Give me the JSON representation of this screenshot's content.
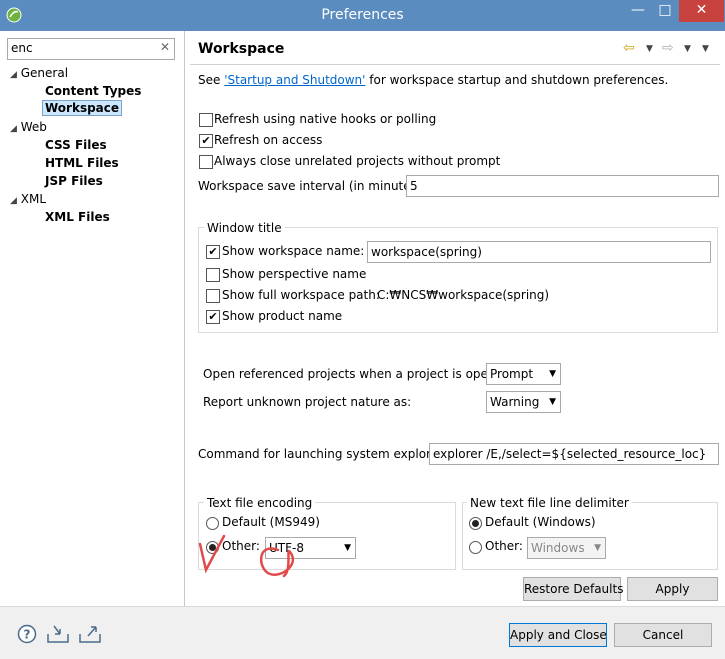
{
  "window": {
    "title": "Preferences",
    "minimize": "—",
    "maximize": "□",
    "close": "✕"
  },
  "filter": {
    "value": "enc",
    "clear": "✕"
  },
  "tree": [
    {
      "label": "General",
      "children": [
        "Content Types",
        "Workspace"
      ]
    },
    {
      "label": "Web",
      "children": [
        "CSS Files",
        "HTML Files",
        "JSP Files"
      ]
    },
    {
      "label": "XML",
      "children": [
        "XML Files"
      ]
    }
  ],
  "page": {
    "title": "Workspace",
    "see_prefix": "See ",
    "see_link": "'Startup and Shutdown'",
    "see_suffix": " for workspace startup and shutdown preferences.",
    "refresh_native": "Refresh using native hooks or polling",
    "refresh_access": "Refresh on access",
    "always_close": "Always close unrelated projects without prompt",
    "save_interval_label": "Workspace save interval (in minutes):",
    "save_interval_value": "5",
    "window_title": {
      "group": "Window title",
      "show_ws_name": "Show workspace name:",
      "ws_name_value": "workspace(spring)",
      "show_perspective": "Show perspective name",
      "show_full_path": "Show full workspace path:",
      "full_path_value": "C:₩NCS₩workspace(spring)",
      "show_product": "Show product name"
    },
    "open_ref_label": "Open referenced projects when a project is opened:",
    "open_ref_value": "Prompt",
    "report_label": "Report unknown project nature as:",
    "report_value": "Warning",
    "cmd_label": "Command for launching system explorer:",
    "cmd_value": "explorer /E,/select=${selected_resource_loc}",
    "encoding": {
      "group": "Text file encoding",
      "default": "Default (MS949)",
      "other": "Other:",
      "other_value": "UTF-8"
    },
    "delimiter": {
      "group": "New text file line delimiter",
      "default": "Default (Windows)",
      "other": "Other:",
      "other_value": "Windows"
    },
    "restore": "Restore Defaults",
    "apply": "Apply"
  },
  "footer": {
    "apply_close": "Apply and Close",
    "cancel": "Cancel"
  },
  "colors": {
    "titlebar": "#5a8cc0",
    "link": "#0066cc",
    "annotation": "#e24a4a"
  }
}
